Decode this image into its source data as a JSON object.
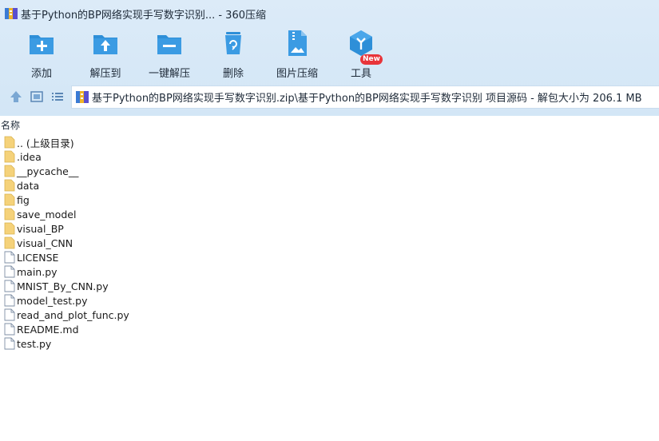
{
  "window": {
    "title": "基于Python的BP网络实现手写数字识别... - 360压缩",
    "app_logo_icon": "archive-stack-icon"
  },
  "toolbar": {
    "items": [
      {
        "label": "添加",
        "icon": "add-folder-icon",
        "color": "#2e8fd8"
      },
      {
        "label": "解压到",
        "icon": "extract-to-folder-icon",
        "color": "#2e8fd8"
      },
      {
        "label": "一键解压",
        "icon": "one-click-extract-icon",
        "color": "#2e8fd8"
      },
      {
        "label": "删除",
        "icon": "recycle-bin-icon",
        "color": "#2e8fd8"
      },
      {
        "label": "图片压缩",
        "icon": "image-compress-icon",
        "color": "#2e8fd8"
      },
      {
        "label": "工具",
        "icon": "tools-cube-icon",
        "color": "#2e8fd8"
      }
    ],
    "new_badge": "New"
  },
  "address_bar": {
    "path": "基于Python的BP网络实现手写数字识别.zip\\基于Python的BP网络实现手写数字识别 项目源码 - 解包大小为 206.1 MB",
    "nav": [
      "up-arrow-icon",
      "thumbnail-view-icon",
      "list-view-icon"
    ]
  },
  "columns": {
    "name": "名称"
  },
  "files": [
    {
      "name": ".. (上级目录)",
      "type": "folder"
    },
    {
      "name": ".idea",
      "type": "folder"
    },
    {
      "name": "__pycache__",
      "type": "folder"
    },
    {
      "name": "data",
      "type": "folder"
    },
    {
      "name": "fig",
      "type": "folder"
    },
    {
      "name": "save_model",
      "type": "folder"
    },
    {
      "name": "visual_BP",
      "type": "folder"
    },
    {
      "name": "visual_CNN",
      "type": "folder"
    },
    {
      "name": "LICENSE",
      "type": "file"
    },
    {
      "name": "main.py",
      "type": "file"
    },
    {
      "name": "MNIST_By_CNN.py",
      "type": "file"
    },
    {
      "name": "model_test.py",
      "type": "file"
    },
    {
      "name": "read_and_plot_func.py",
      "type": "file"
    },
    {
      "name": "README.md",
      "type": "file"
    },
    {
      "name": "test.py",
      "type": "file"
    }
  ],
  "colors": {
    "toolbar_bg": "#d8e9f7",
    "accent": "#2e8fd8",
    "folder": "#f5d27a",
    "badge": "#e8343a"
  }
}
